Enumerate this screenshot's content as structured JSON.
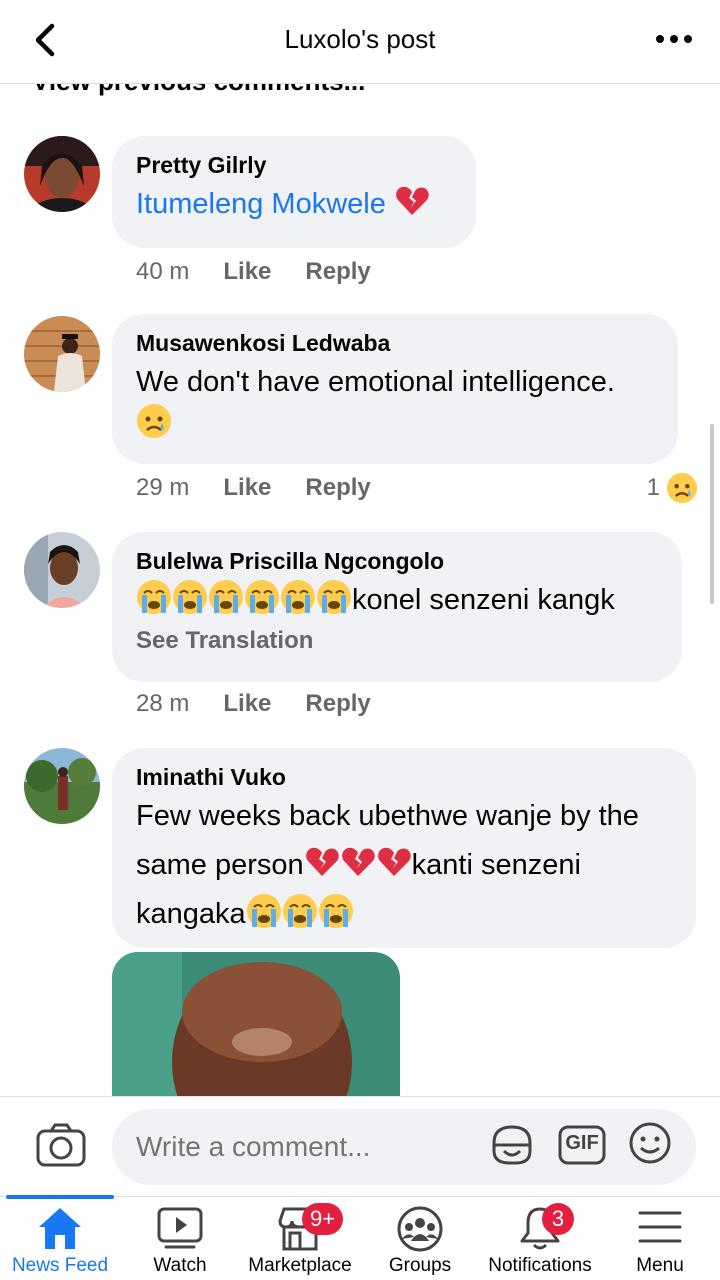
{
  "header": {
    "title": "Luxolo's post"
  },
  "feed": {
    "previous_label": "View previous comments...",
    "comments": [
      {
        "author": "Pretty Gilrly",
        "text": "Itumeleng Mokwele",
        "time": "40 m",
        "like": "Like",
        "reply": "Reply"
      },
      {
        "author": "Musawenkosi Ledwaba",
        "text": "We don't have emotional intelligence.",
        "time": "29 m",
        "like": "Like",
        "reply": "Reply",
        "reaction_count": "1"
      },
      {
        "author": "Bulelwa Priscilla Ngcongolo",
        "text": "konel senzeni kangk",
        "see_translation": "See Translation",
        "time": "28 m",
        "like": "Like",
        "reply": "Reply"
      },
      {
        "author": "Iminathi Vuko",
        "text_line1": "Few weeks back ubethwe wanje by the",
        "text_line2_a": "same person",
        "text_line2_b": "kanti senzeni",
        "text_line3": "kangaka"
      }
    ]
  },
  "composer": {
    "placeholder": "Write a comment...",
    "gif_label": "GIF"
  },
  "nav": {
    "items": [
      {
        "label": "News Feed",
        "icon": "home-icon",
        "active": true
      },
      {
        "label": "Watch",
        "icon": "watch-icon"
      },
      {
        "label": "Marketplace",
        "icon": "marketplace-icon",
        "badge": "9+"
      },
      {
        "label": "Groups",
        "icon": "groups-icon"
      },
      {
        "label": "Notifications",
        "icon": "bell-icon",
        "badge": "3"
      },
      {
        "label": "Menu",
        "icon": "menu-icon"
      }
    ]
  },
  "colors": {
    "link": "#1877f2",
    "badge": "#e41e3f",
    "bubble": "#f0f2f5",
    "muted": "#65676b"
  }
}
